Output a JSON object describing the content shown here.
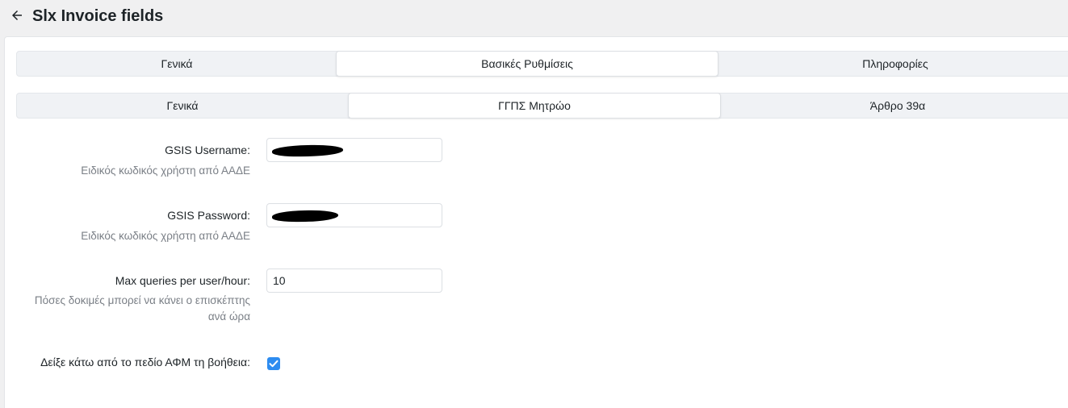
{
  "header": {
    "title": "Slx Invoice fields"
  },
  "tabs_main": [
    {
      "label": "Γενικά"
    },
    {
      "label": "Βασικές Ρυθμίσεις"
    },
    {
      "label": "Πληροφορίες"
    }
  ],
  "tabs_sub": [
    {
      "label": "Γενικά"
    },
    {
      "label": "ΓΓΠΣ Μητρώο"
    },
    {
      "label": "Άρθρο 39α"
    }
  ],
  "fields": {
    "username": {
      "label": "GSIS Username:",
      "hint": "Ειδικός κωδικός χρήστη από ΑΑΔΕ",
      "value": ""
    },
    "password": {
      "label": "GSIS Password:",
      "hint": "Ειδικός κωδικός χρήστη από ΑΑΔΕ",
      "value": ""
    },
    "max_queries": {
      "label": "Max queries per user/hour:",
      "hint_line1": "Πόσες δοκιμές μπορεί να κάνει ο επισκέπτης",
      "hint_line2": "ανά ώρα",
      "value": "10"
    },
    "show_help": {
      "label": "Δείξε κάτω από το πεδίο ΑΦΜ τη βοήθεια:",
      "checked": true
    }
  }
}
